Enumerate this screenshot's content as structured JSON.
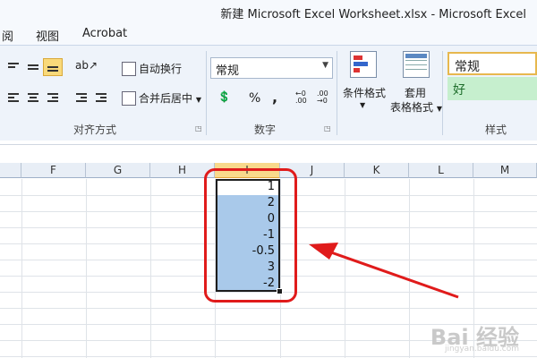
{
  "window": {
    "title": "新建 Microsoft Excel Worksheet.xlsx  -  Microsoft Excel"
  },
  "menu": {
    "items": [
      "阅",
      "视图",
      "Acrobat"
    ]
  },
  "ribbon": {
    "alignment": {
      "wrap_label": "自动换行",
      "merge_label": "合并后居中",
      "group_label": "对齐方式"
    },
    "number": {
      "format_value": "常规",
      "percent_symbol": "%",
      "comma_symbol": ",",
      "group_label": "数字"
    },
    "styles": {
      "conditional_label": "条件格式",
      "table_format_line1": "套用",
      "table_format_line2": "表格格式",
      "normal_style": "常规",
      "good_style": "好",
      "group_label": "样式"
    }
  },
  "sheet": {
    "columns": [
      "F",
      "G",
      "H",
      "I",
      "J",
      "K",
      "L",
      "M"
    ],
    "selected_column": "I",
    "values": [
      "1",
      "2",
      "0",
      "-1",
      "-0.5",
      "3",
      "-2"
    ]
  },
  "watermark": {
    "main": "Bai 经验",
    "sub": "jingyan.baidu.com"
  },
  "colors": {
    "selection": "#a9c9ea",
    "annotation": "#e01b1b",
    "good_style_bg": "#c6efce"
  }
}
